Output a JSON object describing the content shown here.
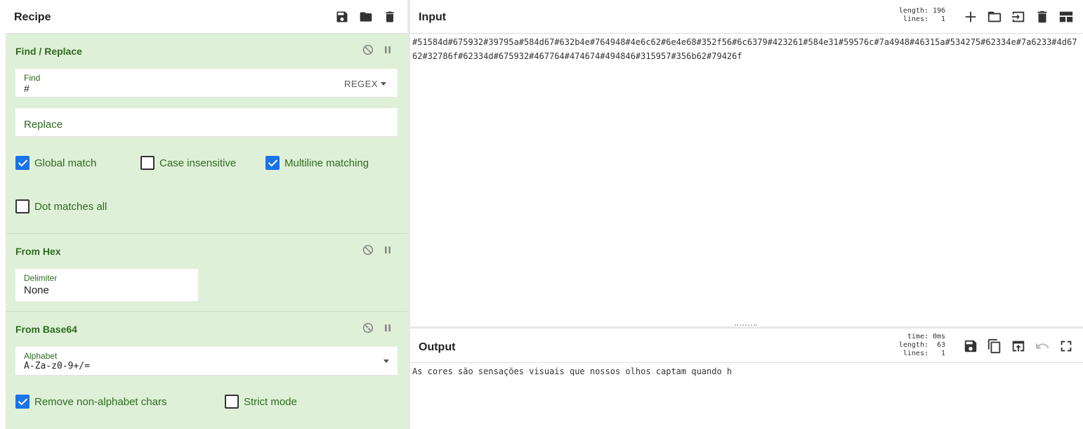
{
  "recipe": {
    "title": "Recipe",
    "operations": {
      "find_replace": {
        "title": "Find / Replace",
        "find_label": "Find",
        "find_value": "#",
        "find_mode": "REGEX",
        "replace_placeholder": "Replace",
        "global_match": {
          "label": "Global match",
          "checked": true
        },
        "case_insensitive": {
          "label": "Case insensitive",
          "checked": false
        },
        "multiline": {
          "label": "Multiline matching",
          "checked": true
        },
        "dot_all": {
          "label": "Dot matches all",
          "checked": false
        }
      },
      "from_hex": {
        "title": "From Hex",
        "delimiter_label": "Delimiter",
        "delimiter_value": "None"
      },
      "from_base64": {
        "title": "From Base64",
        "alphabet_label": "Alphabet",
        "alphabet_value": "A-Za-z0-9+/=",
        "remove_non_alpha": {
          "label": "Remove non-alphabet chars",
          "checked": true
        },
        "strict_mode": {
          "label": "Strict mode",
          "checked": false
        }
      }
    }
  },
  "input": {
    "title": "Input",
    "length_label": "length:",
    "length_value": "196",
    "lines_label": "lines:",
    "lines_value": "1",
    "text": "#51584d#675932#39795a#584d67#632b4e#764948#4e6c62#6e4e68#352f56#6c6379#423261#584e31#59576c#7a4948#46315a#534275#62334e#7a6233#4d6762#32786f#62334d#675932#467764#474674#494846#315957#356b62#79426f"
  },
  "output": {
    "title": "Output",
    "time_label": "time:",
    "time_value": "0ms",
    "length_label": "length:",
    "length_value": "63",
    "lines_label": "lines:",
    "lines_value": "1",
    "text": "As cores são sensações visuais que nossos olhos captam quando h"
  },
  "colors": {
    "accent": "#1a73e8",
    "op_background": "#dff0d8",
    "op_title": "#2e6b1f"
  }
}
